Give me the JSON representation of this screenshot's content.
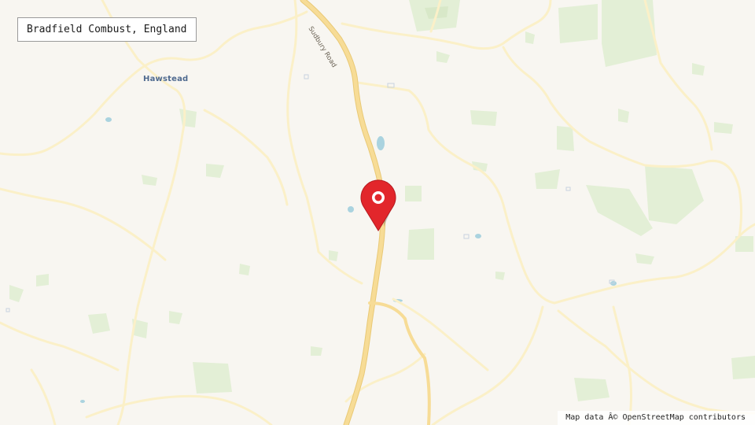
{
  "location_label": "Bradfield Combust, England",
  "places": [
    {
      "name": "Hawstead"
    }
  ],
  "roads": [
    {
      "name": "Sudbury Road"
    }
  ],
  "attribution": "Map data Â© OpenStreetMap contributors",
  "colors": {
    "land": "#f8f6f1",
    "woodland": "#e3efd6",
    "water": "#aad3df",
    "main_road": "#f7dc96",
    "minor_road": "#fbf0c8",
    "marker": "#e2262b",
    "place_label": "#4f6a8f"
  },
  "marker": {
    "icon": "map-pin-icon"
  }
}
